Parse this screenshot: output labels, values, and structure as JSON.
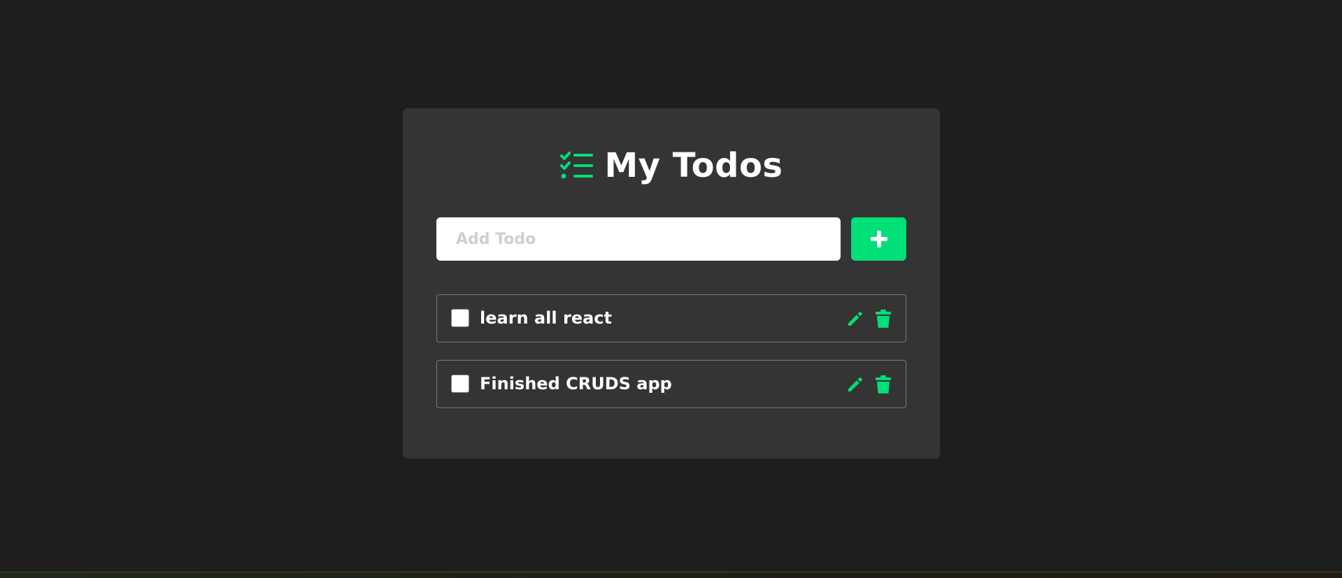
{
  "header": {
    "title": "My Todos",
    "icon": "checklist-icon",
    "accent_color": "#00df78"
  },
  "add_form": {
    "placeholder": "Add Todo",
    "value": "",
    "button_icon": "plus-icon"
  },
  "todos": [
    {
      "text": "learn all react",
      "completed": false,
      "edit_icon": "pencil-icon",
      "delete_icon": "trash-icon"
    },
    {
      "text": "Finished CRUDS app",
      "completed": false,
      "edit_icon": "pencil-icon",
      "delete_icon": "trash-icon"
    }
  ],
  "colors": {
    "background": "#1e1e1e",
    "card": "#343434",
    "accent": "#00df78"
  }
}
